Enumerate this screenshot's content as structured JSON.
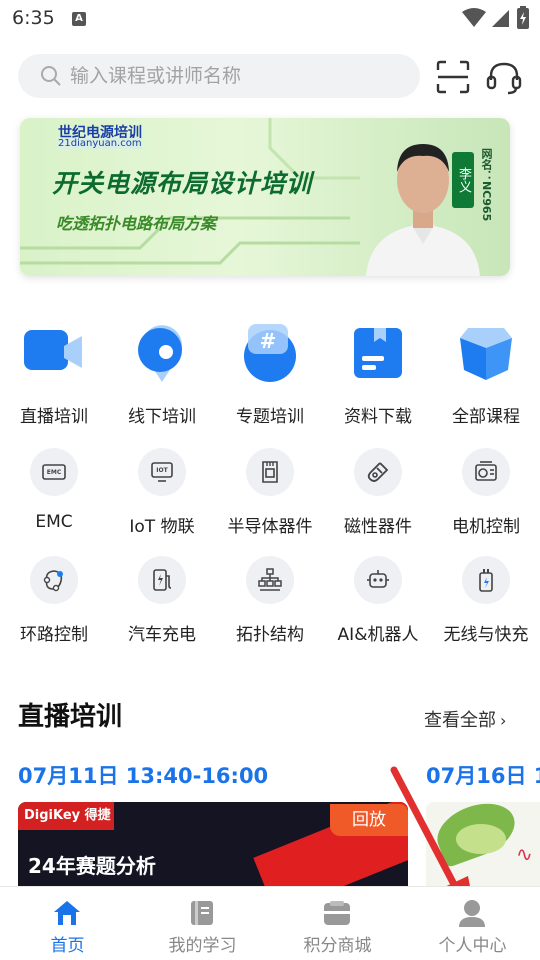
{
  "status_bar": {
    "time": "6:35",
    "notification_icon": "A"
  },
  "search": {
    "placeholder": "输入课程或讲师名称"
  },
  "header_icons": [
    "scan-icon",
    "customer-service-icon"
  ],
  "banner": {
    "brand": "世纪电源培训",
    "brand_url": "21dianyuan.com",
    "title": "开关电源布局设计培训",
    "subtitle": "吃透拓扑电路布局方案",
    "instructor": "李义",
    "instructor_code": "网名：NC965"
  },
  "main_categories": [
    {
      "label": "直播培训",
      "icon": "live-video-icon"
    },
    {
      "label": "线下培训",
      "icon": "location-pin-icon"
    },
    {
      "label": "专题培训",
      "icon": "hashtag-icon"
    },
    {
      "label": "资料下载",
      "icon": "document-icon"
    },
    {
      "label": "全部课程",
      "icon": "box-icon"
    }
  ],
  "sub_categories_row1": [
    {
      "label": "EMC",
      "icon": "emc-icon"
    },
    {
      "label": "IoT 物联",
      "icon": "iot-monitor-icon"
    },
    {
      "label": "半导体器件",
      "icon": "chip-icon"
    },
    {
      "label": "磁性器件",
      "icon": "magnet-icon"
    },
    {
      "label": "电机控制",
      "icon": "motor-icon"
    }
  ],
  "sub_categories_row2": [
    {
      "label": "环路控制",
      "icon": "loop-icon"
    },
    {
      "label": "汽车充电",
      "icon": "charging-station-icon"
    },
    {
      "label": "拓扑结构",
      "icon": "topology-icon"
    },
    {
      "label": "AI&机器人",
      "icon": "robot-icon"
    },
    {
      "label": "无线与快充",
      "icon": "battery-charge-icon"
    }
  ],
  "live_section": {
    "title": "直播培训",
    "see_all": "查看全部",
    "cards": [
      {
        "date": "07月11日 13:40-16:00",
        "sponsor": "DigiKey 得捷",
        "badge": "回放",
        "title": "24年赛题分析"
      },
      {
        "date": "07月16日 1"
      }
    ]
  },
  "tab_bar": [
    {
      "label": "首页",
      "icon": "home-icon",
      "active": true
    },
    {
      "label": "我的学习",
      "icon": "book-icon",
      "active": false
    },
    {
      "label": "积分商城",
      "icon": "store-icon",
      "active": false
    },
    {
      "label": "个人中心",
      "icon": "person-icon",
      "active": false
    }
  ],
  "colors": {
    "accent": "#1a73e8",
    "replay_badge": "#f05a28",
    "annotation_arrow": "#e23030"
  }
}
